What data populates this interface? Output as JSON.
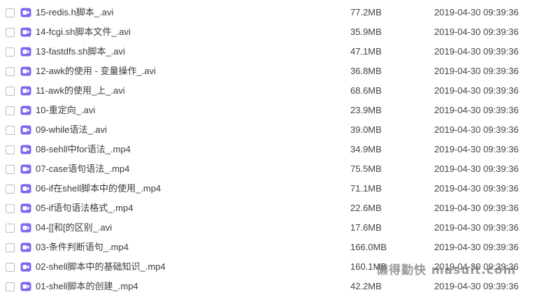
{
  "files": [
    {
      "name": "15-redis.h脚本_.avi",
      "size": "77.2MB",
      "date": "2019-04-30 09:39:36"
    },
    {
      "name": "14-fcgi.sh脚本文件_.avi",
      "size": "35.9MB",
      "date": "2019-04-30 09:39:36"
    },
    {
      "name": "13-fastdfs.sh脚本_.avi",
      "size": "47.1MB",
      "date": "2019-04-30 09:39:36"
    },
    {
      "name": "12-awk的使用 - 变量操作_.avi",
      "size": "36.8MB",
      "date": "2019-04-30 09:39:36"
    },
    {
      "name": "11-awk的使用_上_.avi",
      "size": "68.6MB",
      "date": "2019-04-30 09:39:36"
    },
    {
      "name": "10-重定向_.avi",
      "size": "23.9MB",
      "date": "2019-04-30 09:39:36"
    },
    {
      "name": "09-while语法_.avi",
      "size": "39.0MB",
      "date": "2019-04-30 09:39:36"
    },
    {
      "name": "08-sehll中for语法_.mp4",
      "size": "34.9MB",
      "date": "2019-04-30 09:39:36"
    },
    {
      "name": "07-case语句语法_.mp4",
      "size": "75.5MB",
      "date": "2019-04-30 09:39:36"
    },
    {
      "name": "06-if在shell脚本中的使用_.mp4",
      "size": "71.1MB",
      "date": "2019-04-30 09:39:36"
    },
    {
      "name": "05-if语句语法格式_.mp4",
      "size": "22.6MB",
      "date": "2019-04-30 09:39:36"
    },
    {
      "name": "04-[[和[的区别_.avi",
      "size": "17.6MB",
      "date": "2019-04-30 09:39:36"
    },
    {
      "name": "03-条件判断语句_.mp4",
      "size": "166.0MB",
      "date": "2019-04-30 09:39:36"
    },
    {
      "name": "02-shell脚本中的基础知识_.mp4",
      "size": "160.1MB",
      "date": "2019-04-30 09:39:36"
    },
    {
      "name": "01-shell脚本的创建_.mp4",
      "size": "42.2MB",
      "date": "2019-04-30 09:39:36"
    }
  ],
  "icon": "video-file-icon",
  "colors": {
    "icon": "#7a68f0",
    "checkbox_border": "#b9bec6"
  },
  "watermark": "懒得勤快 masuit.com"
}
